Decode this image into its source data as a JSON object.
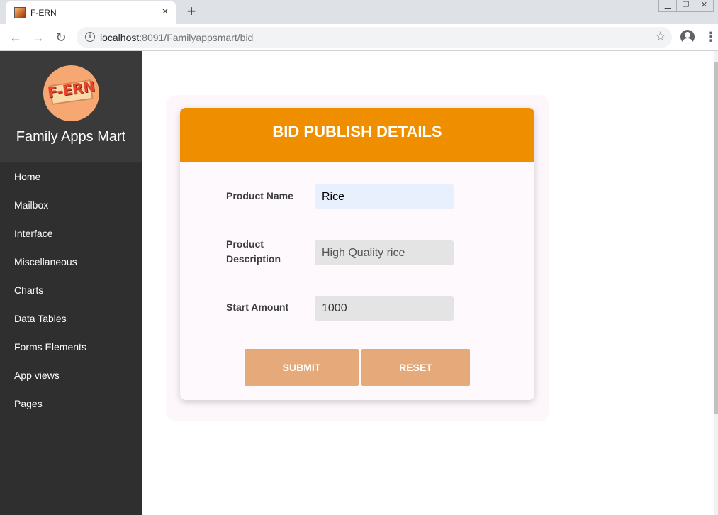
{
  "browser": {
    "tab_title": "F-ERN",
    "url_host": "localhost",
    "url_rest": ":8091/Familyappsmart/bid",
    "tab_close": "×",
    "new_tab": "+"
  },
  "sidebar": {
    "logo_text": "F-ERN",
    "brand_name": "Family Apps Mart",
    "items": [
      {
        "label": "Home"
      },
      {
        "label": "Mailbox"
      },
      {
        "label": "Interface"
      },
      {
        "label": "Miscellaneous"
      },
      {
        "label": "Charts"
      },
      {
        "label": "Data Tables"
      },
      {
        "label": "Forms Elements"
      },
      {
        "label": "App views"
      },
      {
        "label": "Pages"
      }
    ]
  },
  "form": {
    "title": "BID PUBLISH DETAILS",
    "product_name_label": "Product Name",
    "product_name_value": "Rice",
    "product_description_label_line1": "Product",
    "product_description_label_line2": "Description",
    "product_description_value": "High Quality rice",
    "start_amount_label": "Start Amount",
    "start_amount_value": "1000",
    "submit_label": "SUBMIT",
    "reset_label": "RESET"
  },
  "colors": {
    "header_orange": "#ef8f00",
    "button_peach": "#e6aa7a",
    "sidebar_dark": "#2f2f2f"
  }
}
